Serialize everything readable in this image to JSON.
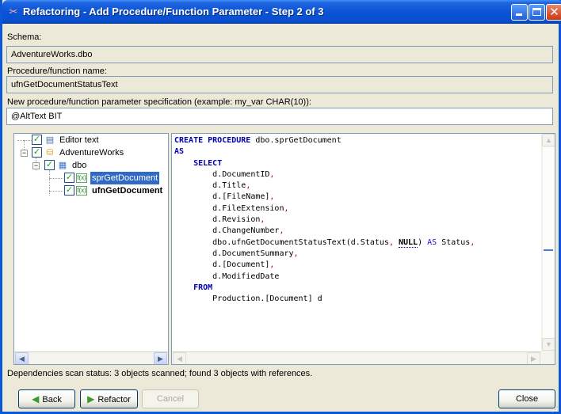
{
  "window": {
    "title": "Refactoring - Add Procedure/Function Parameter - Step 2 of 3",
    "icon": "refactor-icon"
  },
  "form": {
    "schema_label": "Schema:",
    "schema_value": "AdventureWorks.dbo",
    "proc_label": "Procedure/function name:",
    "proc_value": "ufnGetDocumentStatusText",
    "param_label": "New procedure/function parameter specification (example: my_var CHAR(10)):",
    "param_value": "@AltText BIT"
  },
  "tree": {
    "items": [
      {
        "label": "Editor text",
        "icon": "document-icon",
        "checked": true
      },
      {
        "label": "AdventureWorks",
        "icon": "database-icon",
        "checked": true
      },
      {
        "label": "dbo",
        "icon": "schema-icon",
        "checked": true
      },
      {
        "label": "sprGetDocument",
        "icon": "function-icon",
        "checked": true,
        "selected": true
      },
      {
        "label": "ufnGetDocument",
        "icon": "function-icon",
        "checked": true,
        "bold": true
      }
    ],
    "fn_icon_text": "f(x)"
  },
  "code": {
    "lines": [
      "CREATE PROCEDURE dbo.sprGetDocument",
      "AS",
      "    SELECT",
      "        d.DocumentID,",
      "        d.Title,",
      "        d.[FileName],",
      "        d.FileExtension,",
      "        d.Revision,",
      "        d.ChangeNumber,",
      "        dbo.ufnGetDocumentStatusText(d.Status, NULL) AS Status,",
      "        d.DocumentSummary,",
      "        d.[Document],",
      "        d.ModifiedDate",
      "    FROM",
      "        Production.[Document] d"
    ]
  },
  "status": {
    "text": "Dependencies scan status: 3 objects scanned; found 3 objects with references."
  },
  "buttons": {
    "back": "Back",
    "refactor": "Refactor",
    "cancel": "Cancel",
    "close": "Close"
  },
  "colors": {
    "titlebar": "#0a54d6",
    "selection": "#316ac5",
    "keyword": "#0000b0",
    "punctuation": "#b00000"
  }
}
